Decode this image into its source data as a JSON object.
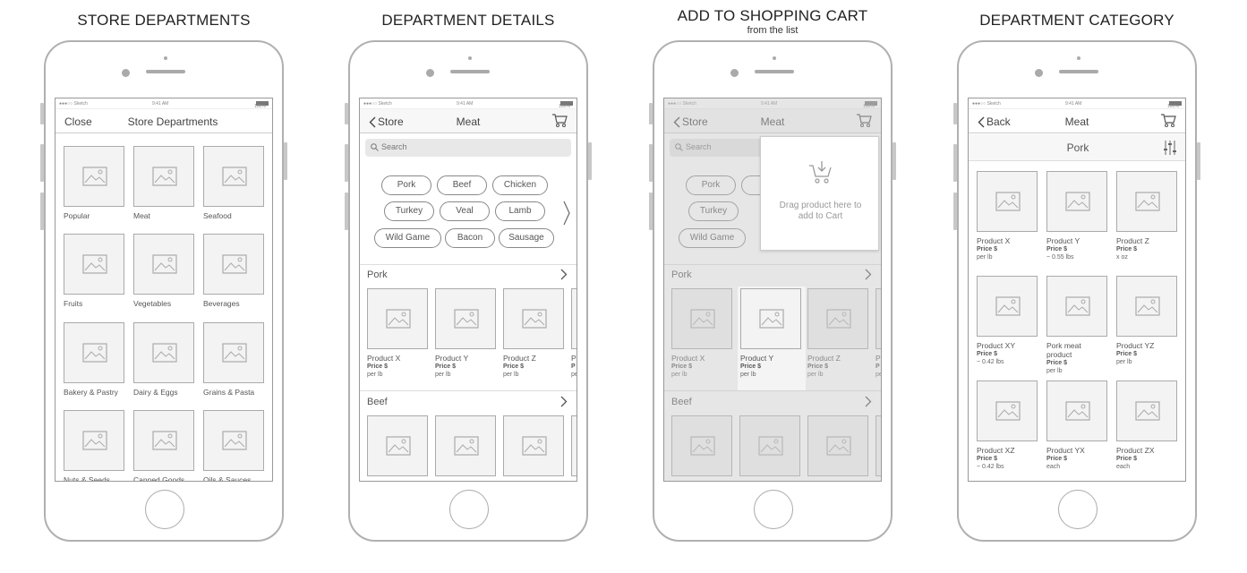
{
  "screens": [
    {
      "heading": "STORE DEPARTMENTS",
      "status": {
        "carrier": "●●●○○ Sketch",
        "time": "9:41 AM",
        "battery": "100%"
      },
      "nav": {
        "left": "Close",
        "title": "Store Departments"
      },
      "departments": [
        "Popular",
        "Meat",
        "Seafood",
        "Fruits",
        "Vegetables",
        "Beverages",
        "Bakery & Pastry",
        "Dairy & Eggs",
        "Grains & Pasta",
        "Nuts & Seeds",
        "Canned Goods",
        "Oils & Sauces"
      ]
    },
    {
      "heading": "DEPARTMENT DETAILS",
      "status": {
        "carrier": "●●●○○ Sketch",
        "time": "9:41 AM",
        "battery": "100%"
      },
      "nav": {
        "left": "Store",
        "title": "Meat"
      },
      "search_placeholder": "Search",
      "chips": [
        "Pork",
        "Beef",
        "Chicken",
        "Turkey",
        "Veal",
        "Lamb",
        "Wild Game",
        "Bacon",
        "Sausage"
      ],
      "sections": [
        {
          "title": "Pork",
          "products": [
            {
              "name": "Product X",
              "price": "Price $",
              "unit": "per lb"
            },
            {
              "name": "Product Y",
              "price": "Price $",
              "unit": "per lb"
            },
            {
              "name": "Product Z",
              "price": "Price $",
              "unit": "per lb"
            },
            {
              "name": "P",
              "price": "P",
              "unit": "pe"
            }
          ]
        },
        {
          "title": "Beef"
        }
      ]
    },
    {
      "heading": "ADD TO SHOPPING CART",
      "subheading": "from the list",
      "status": {
        "carrier": "●●●○○ Sketch",
        "time": "9:41 AM",
        "battery": "100%"
      },
      "nav": {
        "left": "Store",
        "title": "Meat"
      },
      "search_placeholder": "Search",
      "chips": [
        "Pork",
        "B",
        "Turkey",
        "Wild Game"
      ],
      "popup_text_1": "Drag product here to",
      "popup_text_2": "add to Cart",
      "sections": [
        {
          "title": "Pork",
          "products": [
            {
              "name": "Product X",
              "price": "Price $",
              "unit": "per lb"
            },
            {
              "name": "Product Y",
              "price": "Price $",
              "unit": "per lb"
            },
            {
              "name": "Product Z",
              "price": "Price $",
              "unit": "per lb"
            },
            {
              "name": "P",
              "price": "P",
              "unit": "pe"
            }
          ]
        },
        {
          "title": "Beef"
        }
      ]
    },
    {
      "heading": "DEPARTMENT CATEGORY",
      "status": {
        "carrier": "●●●○○ Sketch",
        "time": "9:41 AM",
        "battery": "100%"
      },
      "nav": {
        "left": "Back",
        "title": "Meat"
      },
      "category": "Pork",
      "products": [
        {
          "name": "Product X",
          "price": "Price $",
          "unit": "per lb"
        },
        {
          "name": "Product Y",
          "price": "Price $",
          "unit": "~ 0.55 lbs"
        },
        {
          "name": "Product Z",
          "price": "Price $",
          "unit": "x oz"
        },
        {
          "name": "Product XY",
          "price": "Price $",
          "unit": "~ 0.42 lbs"
        },
        {
          "name": "Pork meat",
          "name2": "product",
          "price": "Price $",
          "unit": "per lb"
        },
        {
          "name": "Product YZ",
          "price": "Price $",
          "unit": "per lb"
        },
        {
          "name": "Product XZ",
          "price": "Price $",
          "unit": "~ 0.42 lbs"
        },
        {
          "name": "Product YX",
          "price": "Price $",
          "unit": "each"
        },
        {
          "name": "Product ZX",
          "price": "Price $",
          "unit": "each"
        }
      ]
    }
  ]
}
